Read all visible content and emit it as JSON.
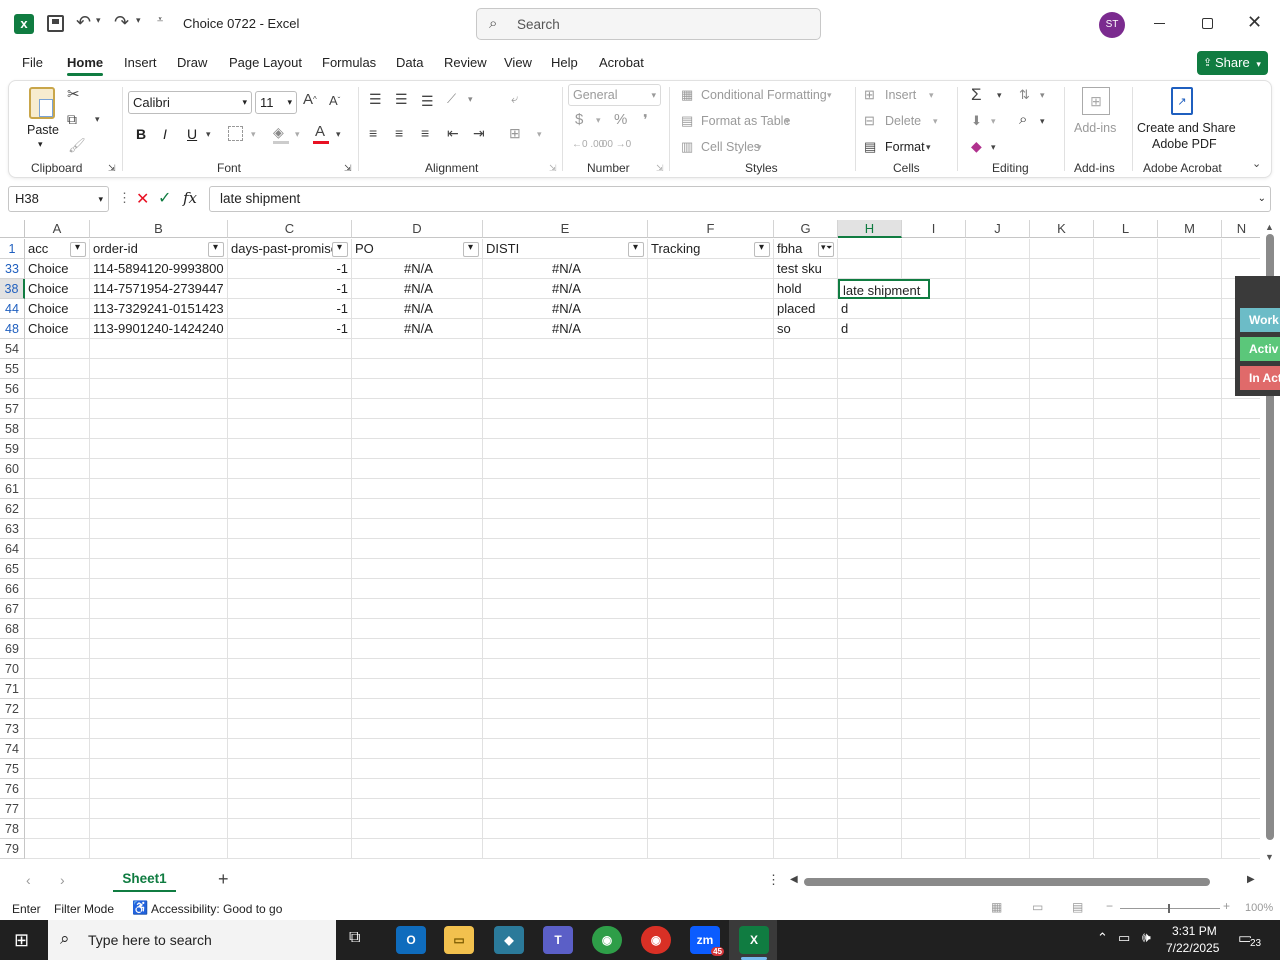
{
  "titlebar": {
    "app_title": "Choice 0722  -  Excel",
    "search_placeholder": "Search",
    "avatar_initials": "ST"
  },
  "ribbon_tabs": [
    "File",
    "Home",
    "Insert",
    "Draw",
    "Page Layout",
    "Formulas",
    "Data",
    "Review",
    "View",
    "Help",
    "Acrobat"
  ],
  "share_label": "Share",
  "ribbon": {
    "paste_label": "Paste",
    "clipboard_label": "Clipboard",
    "font_name": "Calibri",
    "font_size": "11",
    "bold": "B",
    "italic": "I",
    "underline": "U",
    "font_label": "Font",
    "alignment_label": "Alignment",
    "number_format": "General",
    "number_label": "Number",
    "conditional_formatting": "Conditional Formatting",
    "format_as_table": "Format as Table",
    "cell_styles": "Cell Styles",
    "styles_label": "Styles",
    "insert_label": "Insert",
    "delete_label": "Delete",
    "format_label": "Format",
    "cells_label": "Cells",
    "editing_label": "Editing",
    "addins_btn": "Add-ins",
    "addins_label": "Add-ins",
    "create_pdf_line1": "Create and Share",
    "create_pdf_line2": "Adobe PDF",
    "acrobat_label": "Adobe Acrobat"
  },
  "formula_bar": {
    "name_box": "H38",
    "fx": "fx",
    "content": "late shipment"
  },
  "columns": [
    "A",
    "B",
    "C",
    "D",
    "E",
    "F",
    "G",
    "H",
    "I",
    "J",
    "K",
    "L",
    "M",
    "N"
  ],
  "header_row": {
    "num": "1",
    "cells": [
      "acc",
      "order-id",
      "days-past-promise",
      "PO",
      "DISTI",
      "Tracking",
      "fbha",
      "",
      "",
      "",
      "",
      "",
      "",
      ""
    ]
  },
  "data_rows": [
    {
      "num": "33",
      "acc": "Choice",
      "order": "114-5894120-9993800",
      "days": "-1",
      "po": "#N/A",
      "disti": "#N/A",
      "tracking": "",
      "fbha": "test sku",
      "h": ""
    },
    {
      "num": "38",
      "acc": "Choice",
      "order": "114-7571954-2739447",
      "days": "-1",
      "po": "#N/A",
      "disti": "#N/A",
      "tracking": "",
      "fbha": "hold",
      "h": "late shipment"
    },
    {
      "num": "44",
      "acc": "Choice",
      "order": "113-7329241-0151423",
      "days": "-1",
      "po": "#N/A",
      "disti": "#N/A",
      "tracking": "",
      "fbha": "placed",
      "h": "d"
    },
    {
      "num": "48",
      "acc": "Choice",
      "order": "113-9901240-1424240",
      "days": "-1",
      "po": "#N/A",
      "disti": "#N/A",
      "tracking": "",
      "fbha": "so",
      "h": "d"
    }
  ],
  "empty_rows": [
    "54",
    "55",
    "56",
    "57",
    "58",
    "59",
    "60",
    "61",
    "62",
    "63",
    "64",
    "65",
    "66",
    "67",
    "68",
    "69",
    "70",
    "71",
    "72",
    "73",
    "74",
    "75",
    "76",
    "77",
    "78",
    "79"
  ],
  "side_panel": [
    "Work",
    "Activ",
    "In Act"
  ],
  "sheet_tab": "Sheet1",
  "status": {
    "mode": "Enter",
    "filter": "Filter Mode",
    "accessibility": "Accessibility: Good to go",
    "zoom": "100%"
  },
  "taskbar": {
    "search_placeholder": "Type here to search",
    "time": "3:31 PM",
    "date": "7/22/2025",
    "notifications": "23",
    "zoom_badge": "45"
  },
  "colors": {
    "excel_green": "#107c41",
    "accent_blue": "#1f5fbf",
    "avatar": "#7b2b8f"
  }
}
